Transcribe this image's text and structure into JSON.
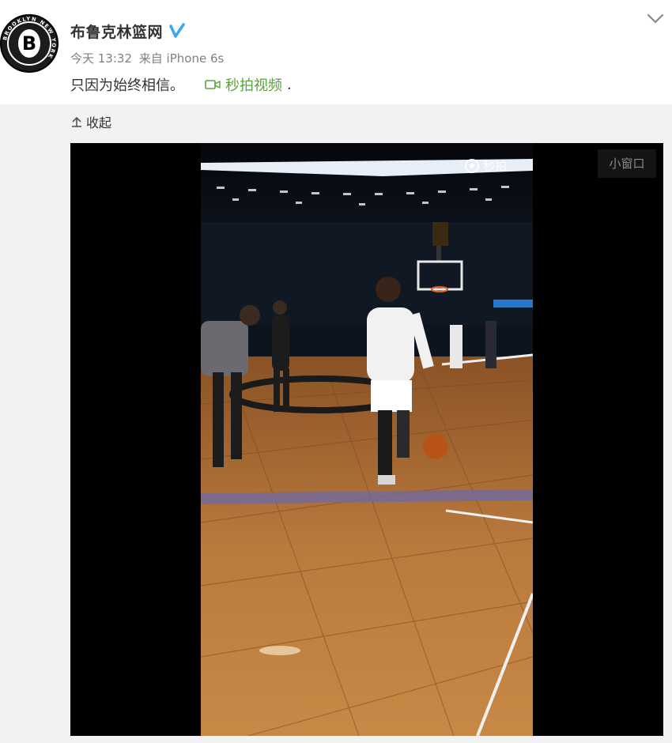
{
  "post": {
    "author": "布鲁克林篮网",
    "avatar_logo_text": "BROOKLYN NEW YORK",
    "avatar_letter": "B",
    "time": "今天 13:32",
    "source": "来自 iPhone 6s",
    "text": "只因为始终相信。",
    "video_link_label": "秒拍视频",
    "period": ".",
    "collapse_label": "收起",
    "mini_window_label": "小窗口",
    "watermark_label": "秒拍"
  },
  "colors": {
    "link_green": "#5aa23a",
    "verified_blue": "#3ba6f0",
    "expand_bg": "#f2f2f5",
    "meta_gray": "#808080"
  },
  "icons": [
    "verified-icon",
    "chevron-down-icon",
    "camera-icon",
    "collapse-arrow-icon",
    "miaopai-icon"
  ]
}
